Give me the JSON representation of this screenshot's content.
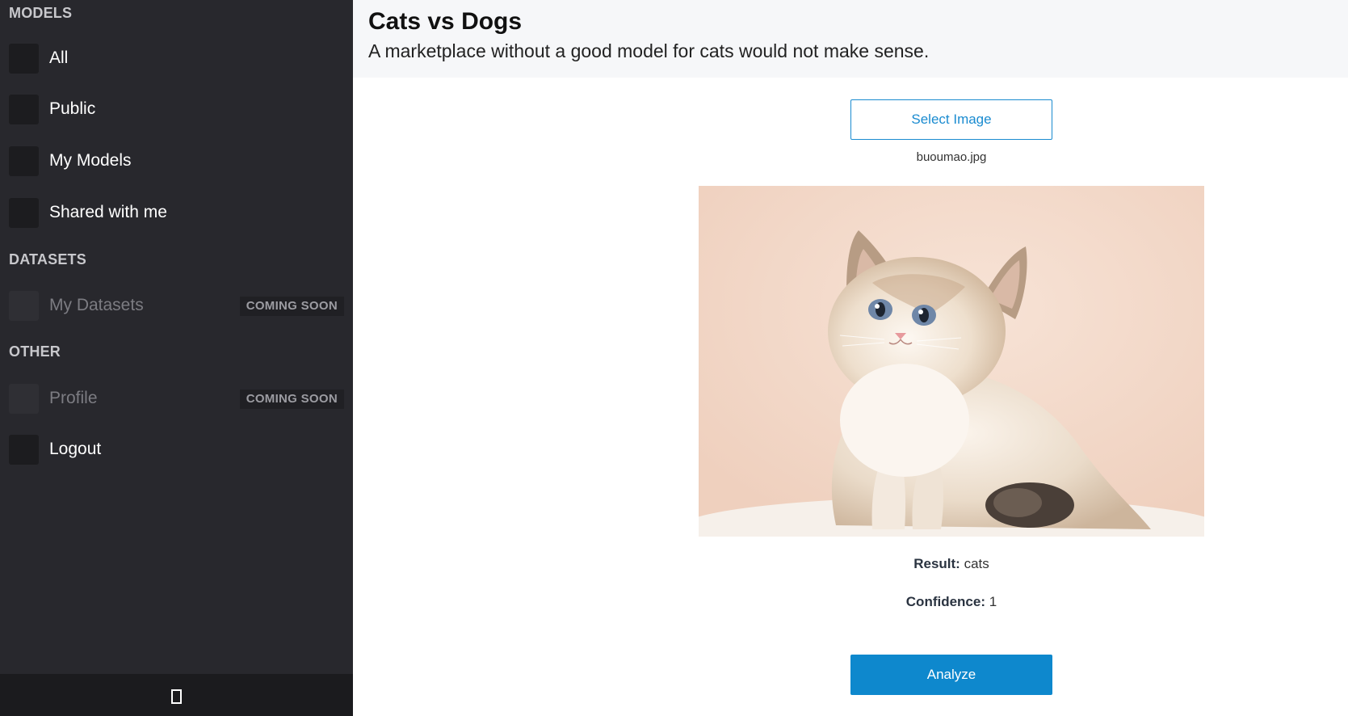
{
  "sidebar": {
    "sections": {
      "models": "MODELS",
      "datasets": "DATASETS",
      "other": "OTHER"
    },
    "items": {
      "all": "All",
      "public": "Public",
      "my_models": "My Models",
      "shared": "Shared with me",
      "my_datasets": "My Datasets",
      "profile": "Profile",
      "logout": "Logout"
    },
    "badge": "COMING SOON",
    "footer_icon": "collapse-sidebar-icon"
  },
  "header": {
    "title": "Cats vs Dogs",
    "subtitle": "A marketplace without a good model for cats would not make sense."
  },
  "upload": {
    "select_label": "Select Image",
    "file_name": "buoumao.jpg"
  },
  "result": {
    "result_label": "Result:",
    "result_value": "cats",
    "confidence_label": "Confidence:",
    "confidence_value": "1"
  },
  "actions": {
    "analyze_label": "Analyze"
  },
  "colors": {
    "sidebar_bg": "#28282d",
    "accent": "#0e88cd",
    "header_bg": "#f6f7f9"
  }
}
